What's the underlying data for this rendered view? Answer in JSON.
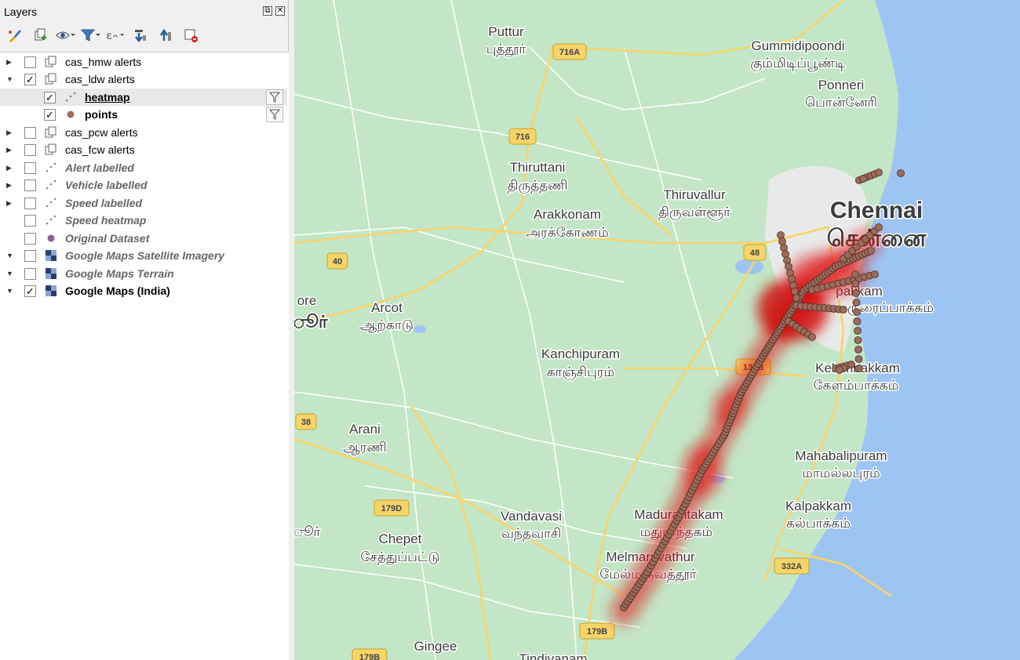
{
  "panel": {
    "title": "Layers",
    "float_glyph": "⧉",
    "close_glyph": "✕"
  },
  "toolbar": [
    {
      "icon": "style-brush-icon"
    },
    {
      "icon": "add-group-icon"
    },
    {
      "icon": "visibility-eye-icon"
    },
    {
      "icon": "filter-legend-icon"
    },
    {
      "icon": "filter-expression-icon"
    },
    {
      "icon": "expand-all-icon"
    },
    {
      "icon": "collapse-all-icon"
    },
    {
      "icon": "remove-layer-icon"
    }
  ],
  "layers": [
    {
      "label": "cas_hmw alerts",
      "checked": false,
      "expanded": false,
      "indent": 0,
      "style": "normal",
      "icon": "group-icon"
    },
    {
      "label": "cas_ldw alerts",
      "checked": true,
      "expanded": true,
      "indent": 0,
      "style": "normal",
      "icon": "group-icon"
    },
    {
      "label": "heatmap",
      "checked": true,
      "indent": 1,
      "style": "bold-underline",
      "icon": "point-cluster-icon",
      "filter": true,
      "selected": true
    },
    {
      "label": "points",
      "checked": true,
      "indent": 1,
      "style": "bold",
      "icon": "brown-point-icon",
      "filter": true
    },
    {
      "label": "cas_pcw alerts",
      "checked": false,
      "expanded": false,
      "indent": 0,
      "style": "normal",
      "icon": "group-icon"
    },
    {
      "label": "cas_fcw alerts",
      "checked": false,
      "expanded": false,
      "indent": 0,
      "style": "normal",
      "icon": "group-icon"
    },
    {
      "label": "Alert labelled",
      "checked": false,
      "expanded": false,
      "indent": 0,
      "style": "off",
      "icon": "point-cluster-icon"
    },
    {
      "label": "Vehicle labelled",
      "checked": false,
      "expanded": false,
      "indent": 0,
      "style": "off",
      "icon": "point-cluster-icon"
    },
    {
      "label": "Speed labelled",
      "checked": false,
      "expanded": false,
      "indent": 0,
      "style": "off",
      "icon": "point-cluster-icon"
    },
    {
      "label": "Speed heatmap",
      "checked": false,
      "indent": 0,
      "style": "off",
      "icon": "point-cluster-icon"
    },
    {
      "label": "Original Dataset",
      "checked": false,
      "indent": 0,
      "style": "off",
      "icon": "purple-point-icon"
    },
    {
      "label": "Google Maps Satellite Imagery",
      "checked": false,
      "expanded": true,
      "indent": 0,
      "style": "off",
      "icon": "raster-tile-icon"
    },
    {
      "label": "Google Maps Terrain",
      "checked": false,
      "expanded": true,
      "indent": 0,
      "style": "off",
      "icon": "raster-tile-icon"
    },
    {
      "label": "Google Maps (India)",
      "checked": true,
      "expanded": true,
      "indent": 0,
      "style": "bold",
      "icon": "raster-tile-icon"
    }
  ],
  "colors": {
    "land": "#c3e6c6",
    "water": "#9dc5f3",
    "urban": "#e8eae9",
    "road_major": "#f9d36b",
    "road_minor": "#ffffff",
    "point_fill": "#9c6b5a",
    "point_stroke": "#4a2e24",
    "heat": "#e01010",
    "brown_point_icon": "#a36d5c",
    "purple_point_icon": "#8e5c9c"
  },
  "map": {
    "places": [
      {
        "en": "Puttur",
        "ta": "புத்தூர்"
      },
      {
        "en": "Gummidipoondi",
        "ta": "கும்மிடிப்பூண்டி"
      },
      {
        "en": "Ponneri",
        "ta": "பொன்னேரி"
      },
      {
        "en": "Thiruttani",
        "ta": "திருத்தணி"
      },
      {
        "en": "Thiruvallur",
        "ta": "திருவள்ளூர்"
      },
      {
        "en": "Arakkonam",
        "ta": "அரக்கோணம்"
      },
      {
        "en": "Chennai",
        "ta": "சென்னை"
      },
      {
        "en": "Arcot",
        "ta": "ஆற்காடு"
      },
      {
        "en": "Kanchipuram",
        "ta": "காஞ்சிபுரம்"
      },
      {
        "en": "pakkam",
        "ta": "ருரைப்பாக்கம்"
      },
      {
        "en": "Kelambakkam",
        "ta": "கேளம்பாக்கம்"
      },
      {
        "en": "Arani",
        "ta": "ஆரணி"
      },
      {
        "en": "Mahabalipuram",
        "ta": "மாமல்லபுரம்"
      },
      {
        "en": "Kalpakkam",
        "ta": "கல்பாக்கம்"
      },
      {
        "en": "Vandavasi",
        "ta": "வந்தவாசி"
      },
      {
        "en": "Madurantakam",
        "ta": "மதுராந்தகம்"
      },
      {
        "en": "Chepet",
        "ta": "சேத்துப்பட்டு"
      },
      {
        "en": "Melmaruvathur",
        "ta": "மேல்மருவத்தூர்"
      },
      {
        "en": "Gingee",
        "ta": ""
      },
      {
        "en": "Tindivanam",
        "ta": ""
      },
      {
        "en": "ore",
        "ta": "ூர்"
      },
      {
        "en": "",
        "ta": "ூர்"
      }
    ],
    "shields": [
      "716A",
      "716",
      "40",
      "48",
      "38",
      "179D",
      "132B",
      "332A",
      "179B",
      "179B"
    ]
  }
}
